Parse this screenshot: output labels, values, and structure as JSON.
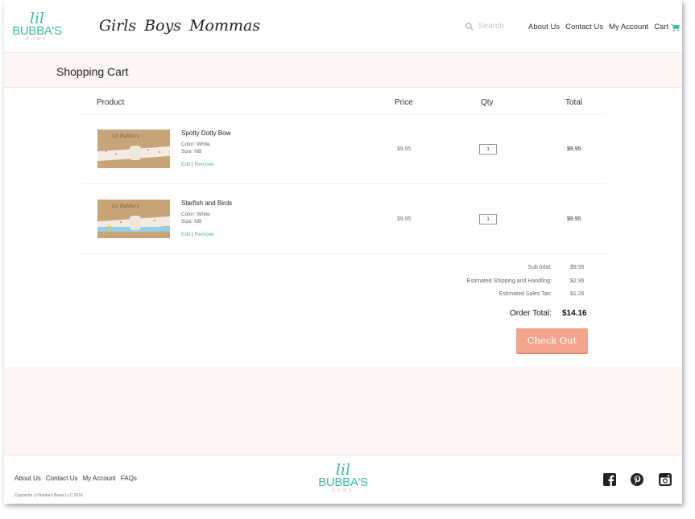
{
  "header": {
    "logo": {
      "line1": "lil",
      "line2": "BUBBA'S",
      "line3": "BOWS"
    },
    "categories": [
      "Girls",
      "Boys",
      "Mommas"
    ],
    "search_placeholder": "Search",
    "nav": [
      "About Us",
      "Contact Us",
      "My Account"
    ],
    "cart_label": "Cart"
  },
  "page_title": "Shopping Cart",
  "table": {
    "headers": {
      "product": "Product",
      "price": "Price",
      "qty": "Qty",
      "total": "Total"
    },
    "items": [
      {
        "name": "Spotty Dotty Bow",
        "color": "Color: White",
        "size": "Size: NB",
        "edit": "Edit",
        "separator": "|",
        "remove": "Remove",
        "price": "$9.95",
        "qty": "1",
        "total": "$9.95",
        "thumb_label": "Lil Bubba's"
      },
      {
        "name": "Starfish and Birds",
        "color": "Color: White",
        "size": "Size: NB",
        "edit": "Edit",
        "separator": "|",
        "remove": "Remove",
        "price": "$9.95",
        "qty": "1",
        "total": "$9.95",
        "thumb_label": "Lil Bubba's"
      }
    ]
  },
  "summary": {
    "subtotal_label": "Sub total:",
    "subtotal": "$9.95",
    "shipping_label": "Estimated Shipping and Handling:",
    "shipping": "$2.95",
    "tax_label": "Estimated Sales Tax:",
    "tax": "$1.26",
    "order_total_label": "Order Total:",
    "order_total": "$14.16"
  },
  "checkout_label": "Check Out",
  "footer": {
    "nav": [
      "About Us",
      "Contact Us",
      "My Account",
      "FAQs"
    ],
    "copyright": "Copywrite Lil Bubba's Bows LLC 2016",
    "logo": {
      "line1": "lil",
      "line2": "BUBBA'S",
      "line3": "BOWS"
    },
    "social_icons": [
      "facebook-icon",
      "pinterest-icon",
      "instagram-icon"
    ]
  },
  "colors": {
    "brand_teal": "#3dbba6",
    "checkout_salmon": "#f4a48c",
    "band_bg": "#fdf6f2"
  }
}
